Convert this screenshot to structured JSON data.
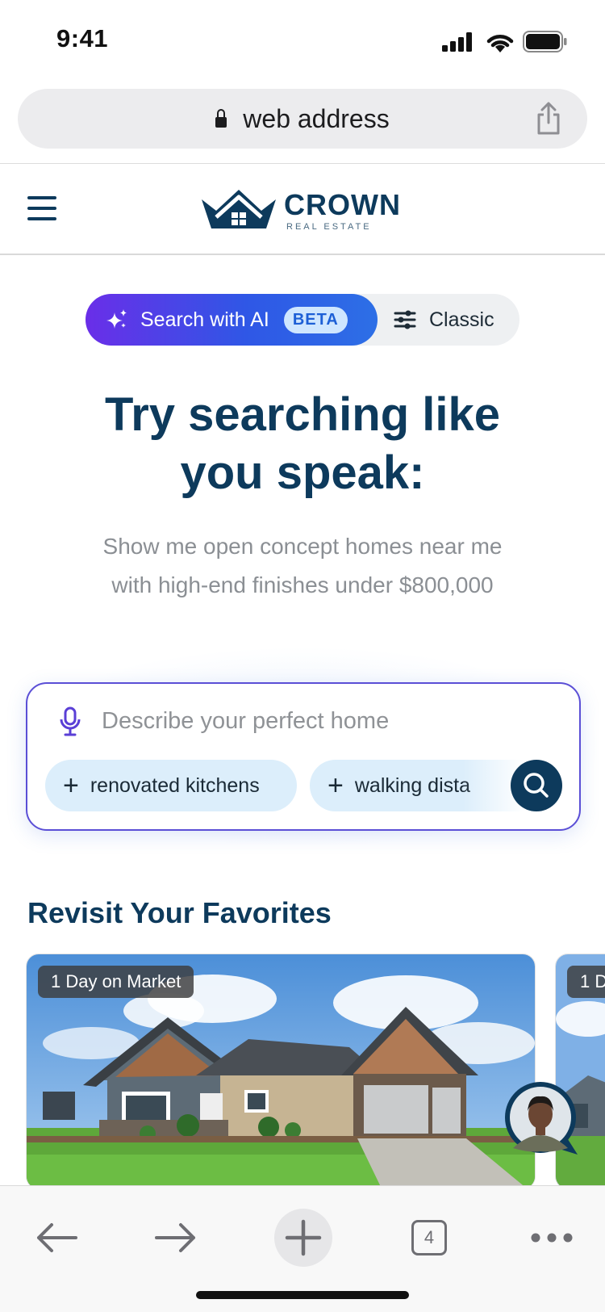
{
  "status_bar": {
    "time": "9:41"
  },
  "browser": {
    "address": "web address"
  },
  "header": {
    "brand_name": "CROWN",
    "brand_sub": "REAL ESTATE"
  },
  "search_mode": {
    "ai_label": "Search with AI",
    "beta_label": "BETA",
    "classic_label": "Classic",
    "active": "ai"
  },
  "hero": {
    "headline_line1": "Try searching like",
    "headline_line2": "you speak:",
    "example_line1": "Show me open concept homes near me",
    "example_line2": "with high-end finishes under $800,000"
  },
  "search": {
    "placeholder": "Describe your perfect home",
    "chips": [
      "renovated kitchens",
      "walking dista"
    ]
  },
  "favorites": {
    "title": "Revisit Your Favorites",
    "cards": [
      {
        "badge": "1 Day on Market"
      },
      {
        "badge": "1 D"
      }
    ]
  },
  "toolbar": {
    "tab_count": "4"
  },
  "colors": {
    "brand_navy": "#0d3a5c",
    "ai_gradient_start": "#6a2ee8",
    "ai_gradient_end": "#2d6fe6",
    "chip_bg": "#dceefb"
  }
}
